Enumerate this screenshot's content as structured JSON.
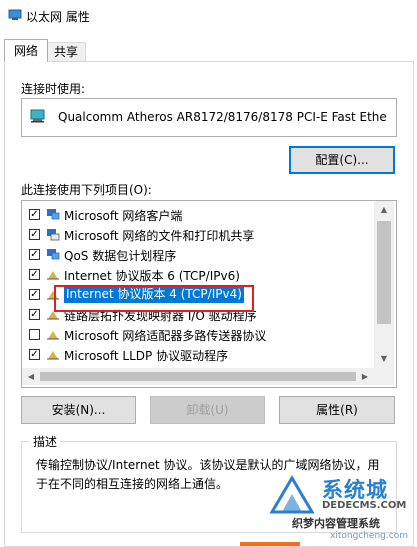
{
  "window": {
    "title": "以太网 属性"
  },
  "tabs": [
    {
      "label": "网络"
    },
    {
      "label": "共享"
    }
  ],
  "connect_using_label": "连接时使用:",
  "adapter": {
    "name": "Qualcomm Atheros AR8172/8176/8178 PCI-E Fast Ethe"
  },
  "configure_button": "配置(C)...",
  "items_label": "此连接使用下列项目(O):",
  "items": [
    {
      "label": "Microsoft 网络客户端",
      "checked": true,
      "icon": "network-client-icon"
    },
    {
      "label": "Microsoft 网络的文件和打印机共享",
      "checked": true,
      "icon": "file-printer-sharing-icon"
    },
    {
      "label": "QoS 数据包计划程序",
      "checked": true,
      "icon": "qos-icon"
    },
    {
      "label": "Internet 协议版本 6 (TCP/IPv6)",
      "checked": true,
      "icon": "protocol-icon"
    },
    {
      "label": "Internet 协议版本 4 (TCP/IPv4)",
      "checked": true,
      "icon": "protocol-icon",
      "selected": true
    },
    {
      "label": "链路层拓扑发现映射器 I/O 驱动程序",
      "checked": true,
      "icon": "protocol-icon"
    },
    {
      "label": "Microsoft 网络适配器多路传送器协议",
      "checked": false,
      "icon": "protocol-icon"
    },
    {
      "label": "Microsoft LLDP 协议驱动程序",
      "checked": true,
      "icon": "protocol-icon"
    }
  ],
  "buttons": {
    "install": "安装(N)...",
    "uninstall": "卸载(U)",
    "properties": "属性(R)"
  },
  "description": {
    "title": "描述",
    "text": "传输控制协议/Internet 协议。该协议是默认的广域网络协议，用于在不同的相互连接的网络上通信。"
  },
  "watermark": {
    "big": "系统城",
    "site": "DEDECMS.COM",
    "brand": "织梦内容管理系统",
    "url": "xitongcheng.com"
  },
  "colors": {
    "selection": "#0078d7",
    "highlight_border": "#e02020"
  }
}
